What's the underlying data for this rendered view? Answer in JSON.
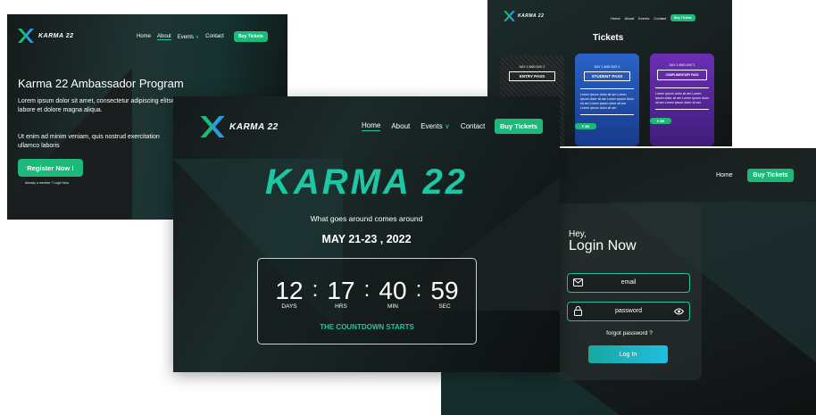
{
  "colors": {
    "accent_green": "#1db87a",
    "teal_text": "#1fc7a1",
    "dark_bg": "#0f1212"
  },
  "brand": {
    "name": "KARMA 22"
  },
  "nav": {
    "home": "Home",
    "about": "About",
    "events": "Events",
    "contact": "Contact",
    "buy_tickets": "Buy Tickets"
  },
  "ambassador": {
    "title": "Karma 22 Ambassador Program",
    "para1": "Lorem ipsum dolor sit amet, consectetur adipiscing elitsed do eiusmod tempor incididunt ut labore et dolore magna aliqua.",
    "para2": "Ut enim ad minim veniam, quis nostrud exercitation ullamco laboris",
    "cta": "Register Now !",
    "login_hint": "Already a member ? Login Now"
  },
  "tickets": {
    "heading": "Tickets",
    "cards": [
      {
        "day": "DAY 1 AND DAY 2",
        "name": "ENTRY PASS",
        "desc": "",
        "price": ""
      },
      {
        "day": "DAY 1 AND DAY 2",
        "name": "STUDENT PASS",
        "desc": "Lorem ipsum dolor sit am Lorem ipsum dolor sit am Lorem ipsum dolor sit am Lorem ipsum dolor sit am Lorem ipsum dolor sit am",
        "price": "₹ 499"
      },
      {
        "day": "DAY 1 AND DAY 2",
        "name": "COMPLIMENTARY PASS",
        "desc": "Lorem ipsum dolor sit am Lorem ipsum dolor sit am Lorem ipsum dolor sit am Lorem ipsum dolor sit am",
        "price": "₹ 499"
      }
    ]
  },
  "hero": {
    "tagline": "What goes around comes around",
    "dates": "MAY 21-23 , 2022",
    "countdown": [
      {
        "value": "12",
        "unit": "DAYS"
      },
      {
        "value": "17",
        "unit": "HRS"
      },
      {
        "value": "40",
        "unit": "MIN"
      },
      {
        "value": "59",
        "unit": "SEC"
      }
    ],
    "separator": ":",
    "countdown_label": "THE COUNTDOWN STARTS"
  },
  "login": {
    "greeting": "Hey,",
    "title": "Login Now",
    "email_placeholder": "email",
    "password_placeholder": "password",
    "forgot": "forgot password ?",
    "submit": "Log In"
  },
  "icons": [
    "logo-mark-icon",
    "chevron-down-icon",
    "mail-icon",
    "lock-icon",
    "eye-icon"
  ]
}
